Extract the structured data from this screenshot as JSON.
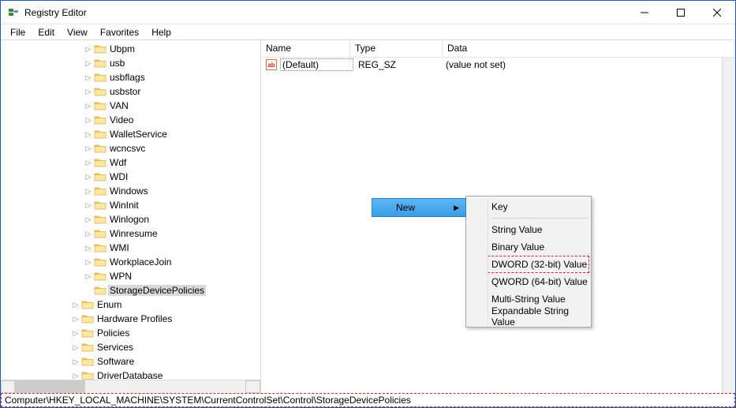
{
  "window": {
    "title": "Registry Editor"
  },
  "menu": {
    "file": "File",
    "edit": "Edit",
    "view": "View",
    "favorites": "Favorites",
    "help": "Help"
  },
  "tree": {
    "items_lvl3": [
      "Ubpm",
      "usb",
      "usbflags",
      "usbstor",
      "VAN",
      "Video",
      "WalletService",
      "wcncsvc",
      "Wdf",
      "WDI",
      "Windows",
      "WinInit",
      "Winlogon",
      "Winresume",
      "WMI",
      "WorkplaceJoin",
      "WPN",
      "StorageDevicePolicies"
    ],
    "items_lvl2": [
      "Enum",
      "Hardware Profiles",
      "Policies",
      "Services",
      "Software",
      "DriverDatabase"
    ]
  },
  "list": {
    "headers": {
      "name": "Name",
      "type": "Type",
      "data": "Data"
    },
    "row": {
      "name": "(Default)",
      "type": "REG_SZ",
      "data": "(value not set)",
      "icon": "ab"
    }
  },
  "context_menu": {
    "new": "New",
    "items": {
      "key": "Key",
      "string": "String Value",
      "binary": "Binary Value",
      "dword": "DWORD (32-bit) Value",
      "qword": "QWORD (64-bit) Value",
      "multi": "Multi-String Value",
      "expand": "Expandable String Value"
    }
  },
  "status": {
    "path": "Computer\\HKEY_LOCAL_MACHINE\\SYSTEM\\CurrentControlSet\\Control\\StorageDevicePolicies"
  }
}
